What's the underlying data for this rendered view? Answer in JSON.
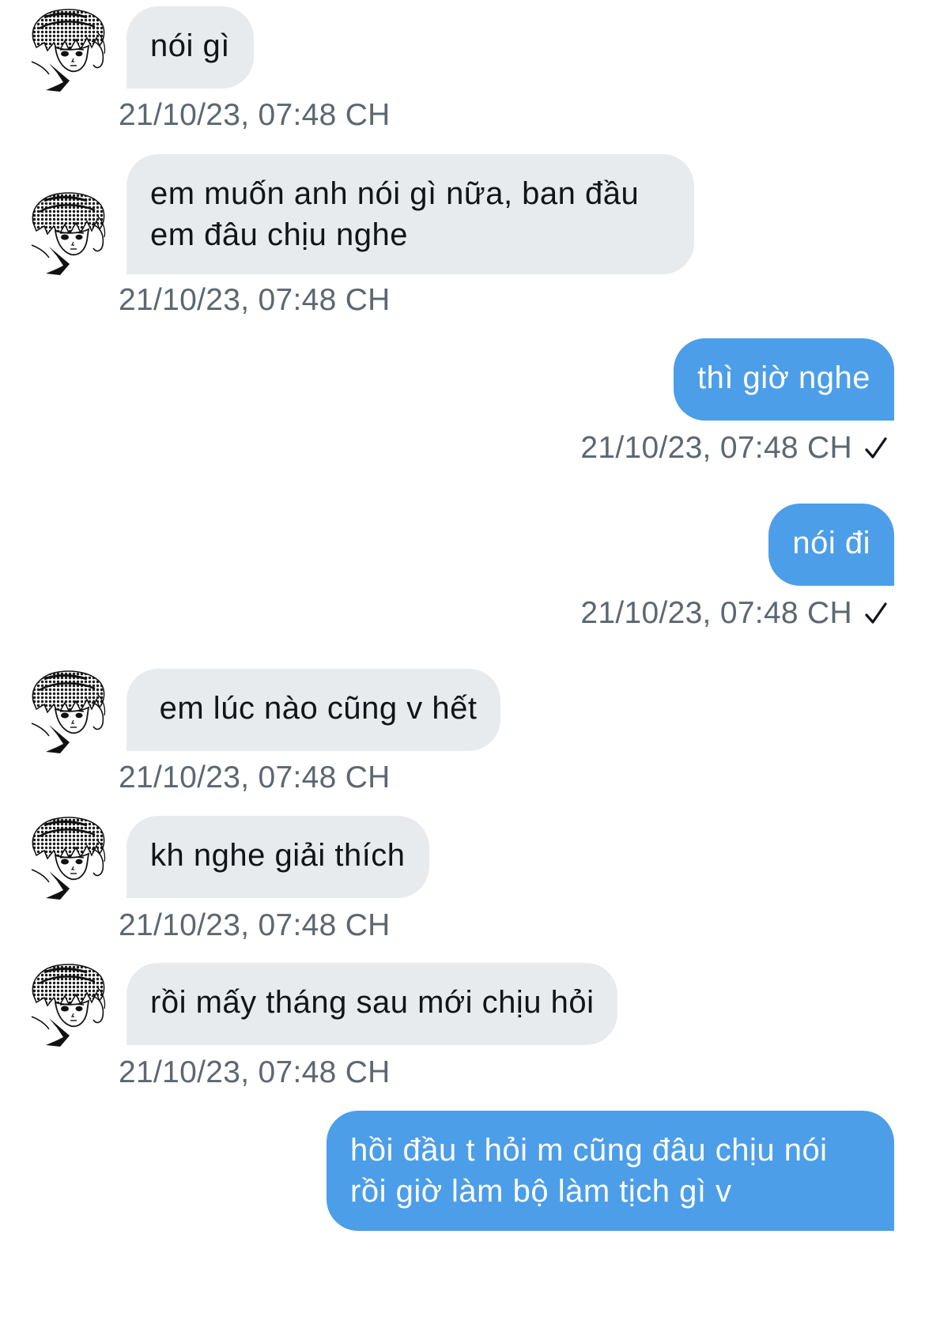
{
  "messages": [
    {
      "direction": "in",
      "text": "nói gì",
      "time": "21/10/23, 07:48 CH"
    },
    {
      "direction": "in",
      "text": "em muốn anh nói gì nữa, ban đầu\nem đâu chịu nghe",
      "time": "21/10/23, 07:48 CH"
    },
    {
      "direction": "out",
      "text": "thì giờ nghe",
      "time": "21/10/23, 07:48 CH",
      "status_icon": "checkmark-icon"
    },
    {
      "direction": "out",
      "text": "nói đi",
      "time": "21/10/23, 07:48 CH",
      "status_icon": "checkmark-icon"
    },
    {
      "direction": "in",
      "text": " em lúc nào cũng v hết",
      "time": "21/10/23, 07:48 CH"
    },
    {
      "direction": "in",
      "text": "kh nghe giải thích",
      "time": "21/10/23, 07:48 CH"
    },
    {
      "direction": "in",
      "text": "rồi mấy tháng sau mới chịu hỏi",
      "time": "21/10/23, 07:48 CH"
    },
    {
      "direction": "out",
      "text": "hồi đầu t hỏi m cũng đâu chịu nói\nrồi giờ làm bộ làm tịch gì v",
      "time": ""
    }
  ],
  "colors": {
    "incoming_bubble": "#e8ebee",
    "outgoing_bubble": "#4c9ee8",
    "incoming_text": "#111418",
    "outgoing_text": "#ffffff",
    "timestamp": "#5d6771"
  },
  "icons": {
    "avatar": "manga-character-avatar-icon",
    "read_status": "checkmark-icon"
  }
}
